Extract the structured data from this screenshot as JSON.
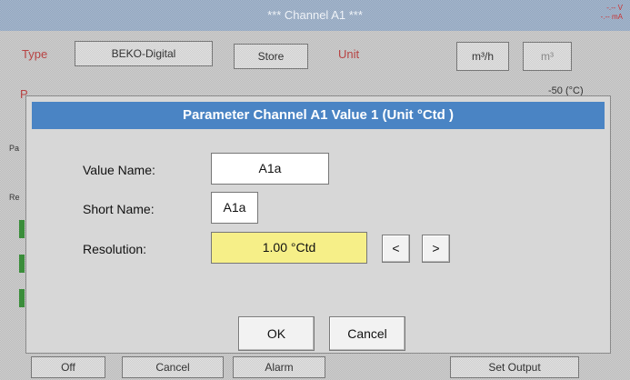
{
  "window": {
    "title": "*** Channel A1 ***",
    "status_top": "-.-- V",
    "status_bottom": "-.-- mA"
  },
  "background": {
    "type_label": "Type",
    "type_value": "BEKO-Digital",
    "store_label": "Store",
    "unit_label": "Unit",
    "unit_options": [
      "m³/h",
      "m³"
    ],
    "side_letters": [
      "P",
      "Pa",
      "Re"
    ],
    "range_fragment": "-50 (°C)",
    "bottom_items": [
      "Off",
      "Cancel",
      "Alarm",
      "Set Output"
    ]
  },
  "dialog": {
    "title": "Parameter Channel A1 Value 1 (Unit °Ctd )",
    "value_name_label": "Value Name:",
    "value_name": "A1a",
    "short_name_label": "Short Name:",
    "short_name": "A1a",
    "resolution_label": "Resolution:",
    "resolution_value": "1.00 °Ctd",
    "prev_label": "<",
    "next_label": ">",
    "ok_label": "OK",
    "cancel_label": "Cancel"
  },
  "colors": {
    "dialog_title_bg": "#4a84c4",
    "resolution_bg": "#f6ef88"
  }
}
